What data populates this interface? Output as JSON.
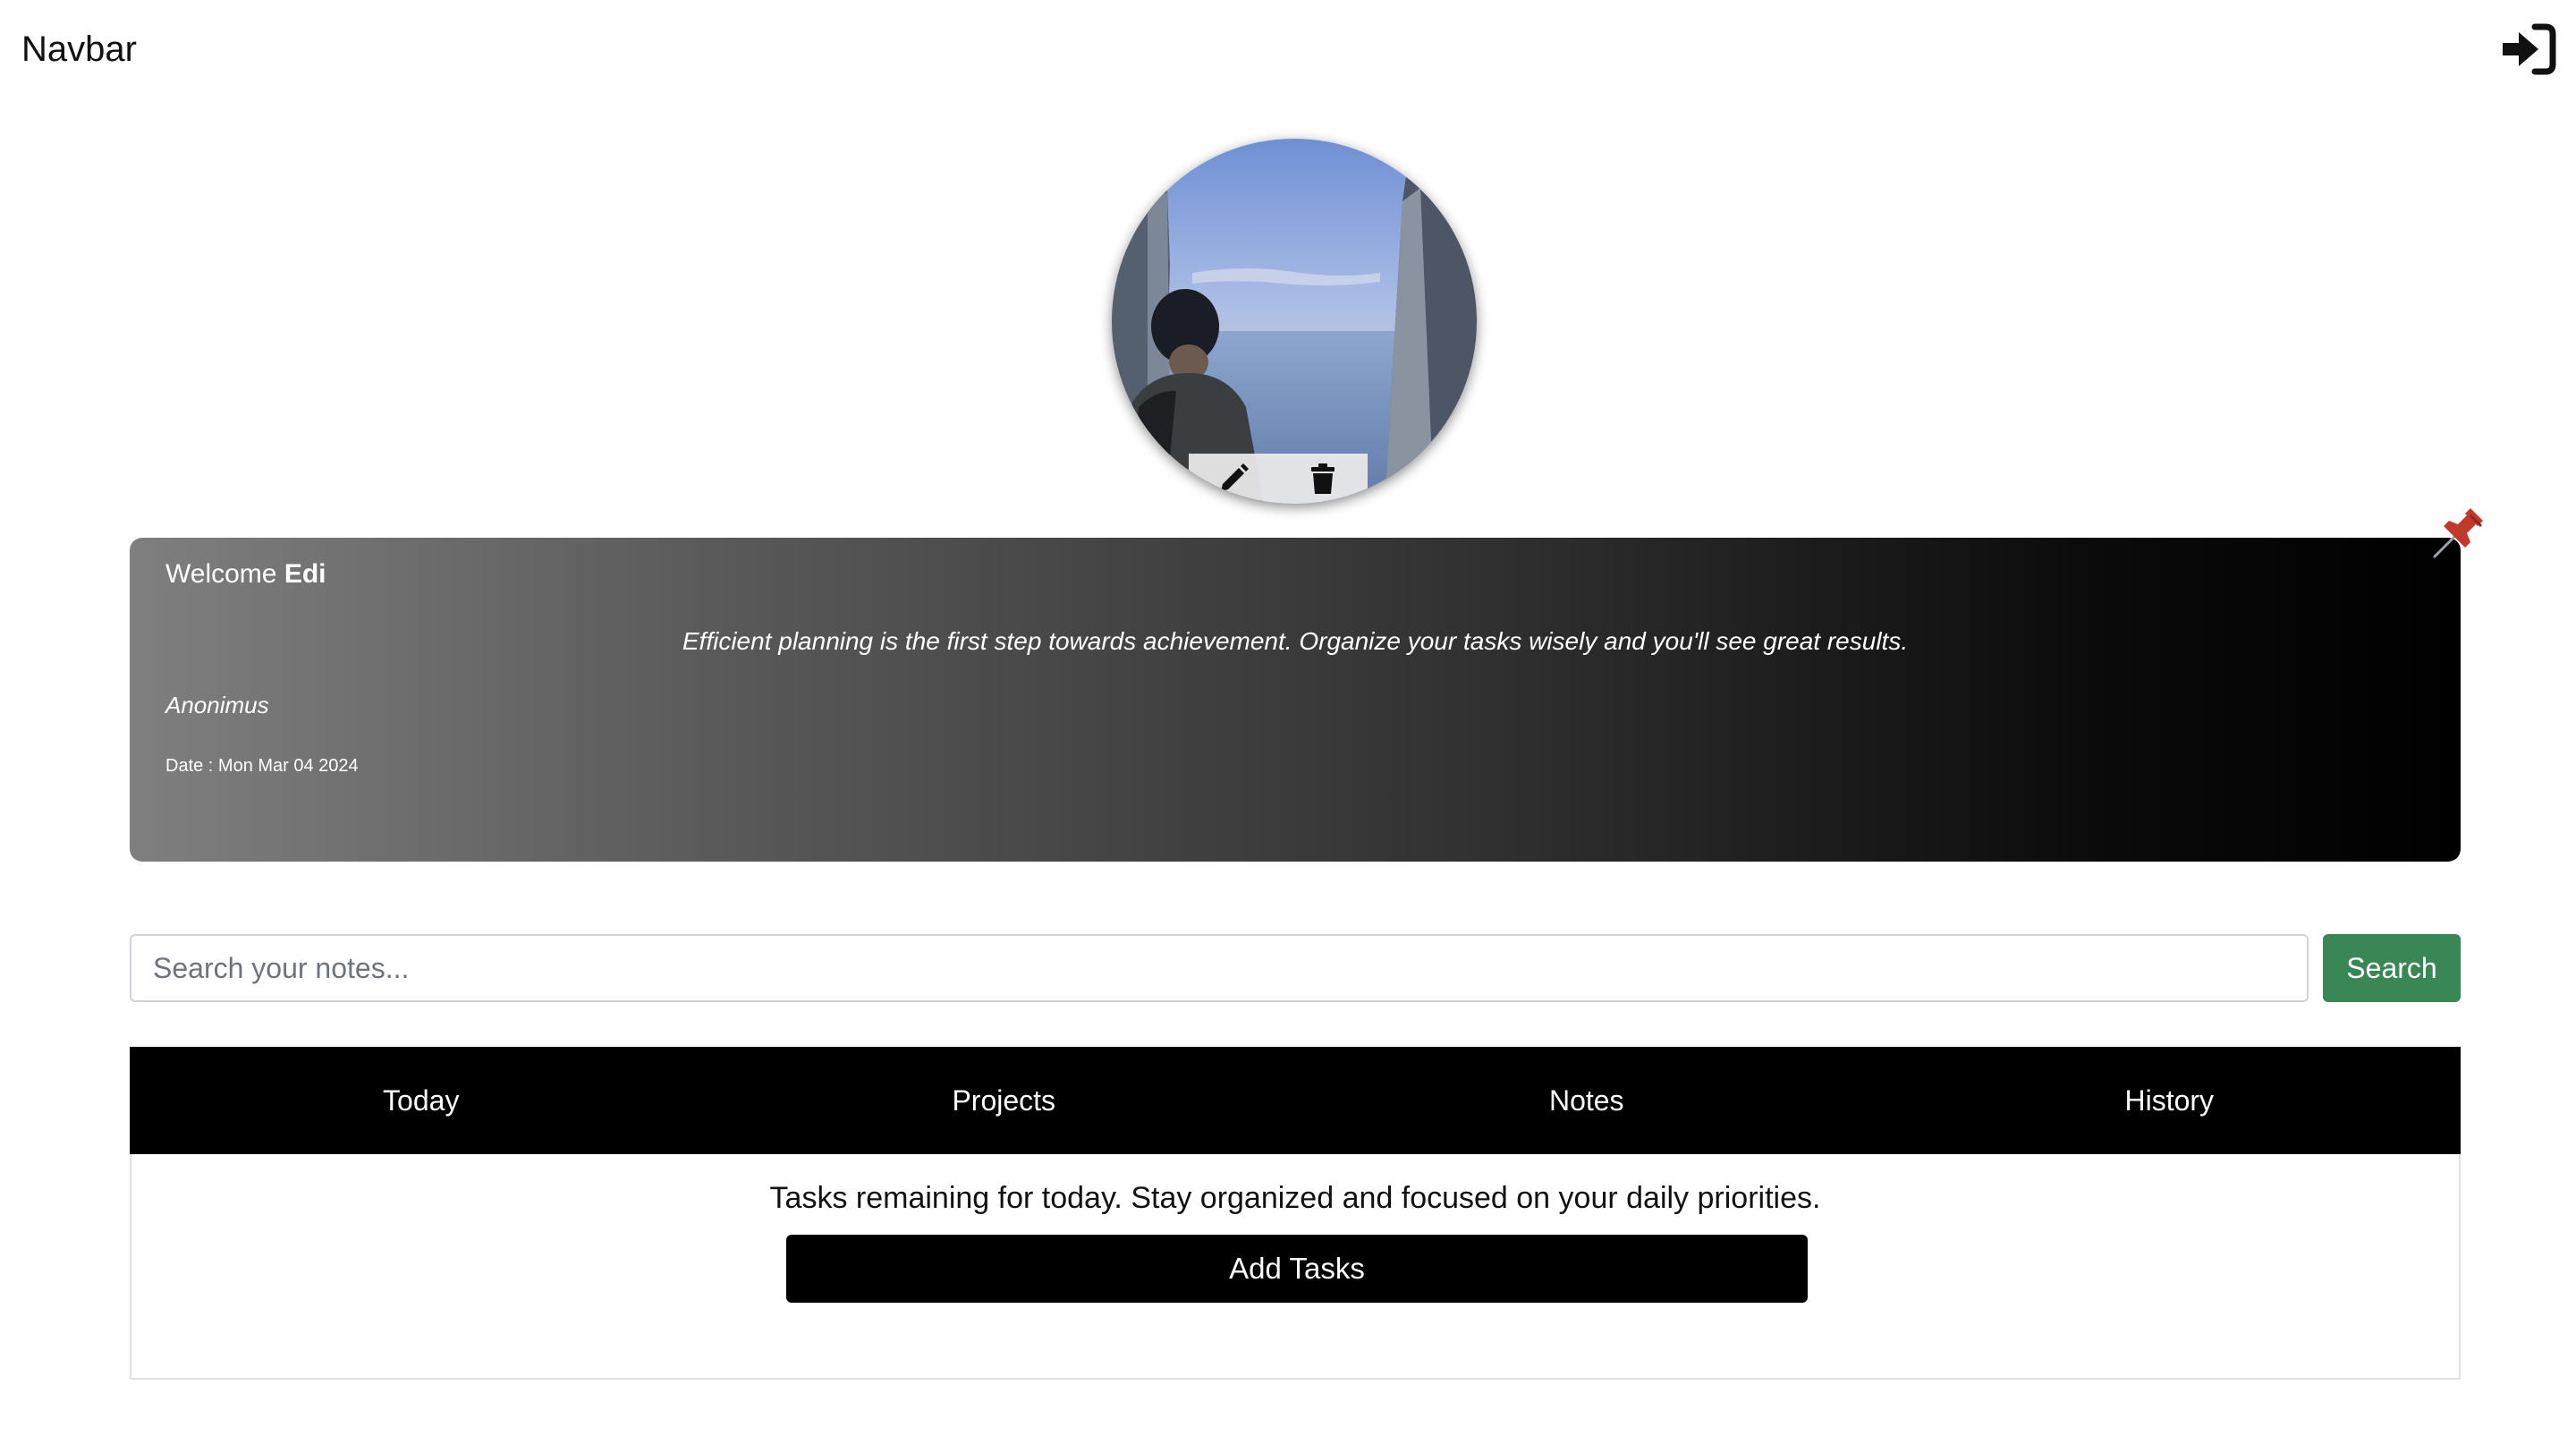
{
  "navbar": {
    "brand": "Navbar",
    "login_icon": "sign-in-icon"
  },
  "profile": {
    "avatar_alt": "profile-photo",
    "edit_icon": "pencil-icon",
    "delete_icon": "trash-icon"
  },
  "welcome": {
    "greeting": "Welcome",
    "username": "Edi",
    "quote": "Efficient planning is the first step towards achievement. Organize your tasks wisely and you'll see great results.",
    "author": "Anonimus",
    "date": "Date : Mon Mar 04 2024",
    "pin_icon": "pushpin-icon"
  },
  "search": {
    "placeholder": "Search your notes...",
    "value": "",
    "button_label": "Search"
  },
  "tabs": [
    {
      "label": "Today"
    },
    {
      "label": "Projects"
    },
    {
      "label": "Notes"
    },
    {
      "label": "History"
    }
  ],
  "today_panel": {
    "message": "Tasks remaining for today. Stay organized and focused on your daily priorities.",
    "add_button_label": "Add Tasks"
  },
  "colors": {
    "search_button": "#3a8756",
    "tab_bar": "#000000",
    "pin": "#c0392b"
  }
}
